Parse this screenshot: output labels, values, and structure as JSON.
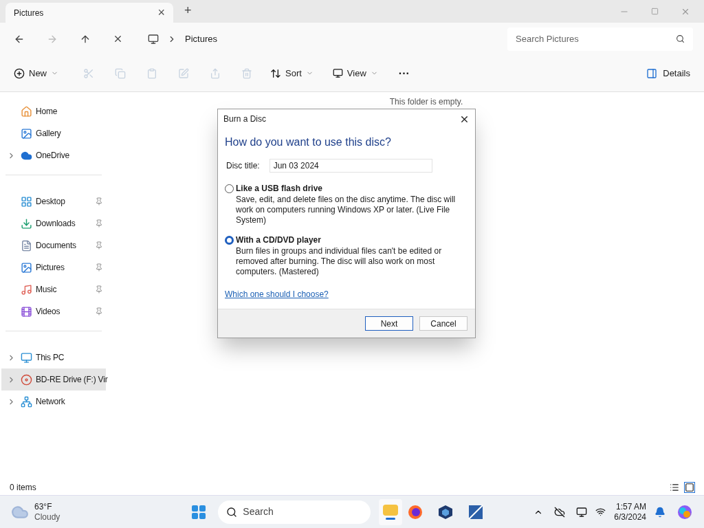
{
  "tab": {
    "title": "Pictures",
    "close": "×",
    "new": "+"
  },
  "address": {
    "breadcrumb": "Pictures",
    "search_placeholder": "Search Pictures"
  },
  "commands": {
    "new": "New",
    "sort": "Sort",
    "view": "View",
    "more": "···",
    "details": "Details"
  },
  "sidebar": {
    "groups": [
      [
        {
          "label": "Home",
          "expandable": false,
          "pinned": false,
          "selected": false
        },
        {
          "label": "Gallery",
          "expandable": false,
          "pinned": false,
          "selected": false
        },
        {
          "label": "OneDrive",
          "expandable": true,
          "pinned": false,
          "selected": false
        }
      ],
      [
        {
          "label": "Desktop",
          "expandable": false,
          "pinned": true,
          "selected": false
        },
        {
          "label": "Downloads",
          "expandable": false,
          "pinned": true,
          "selected": false
        },
        {
          "label": "Documents",
          "expandable": false,
          "pinned": true,
          "selected": false
        },
        {
          "label": "Pictures",
          "expandable": false,
          "pinned": true,
          "selected": false
        },
        {
          "label": "Music",
          "expandable": false,
          "pinned": true,
          "selected": false
        },
        {
          "label": "Videos",
          "expandable": false,
          "pinned": true,
          "selected": false
        }
      ],
      [
        {
          "label": "This PC",
          "expandable": true,
          "pinned": false,
          "selected": false
        },
        {
          "label": "BD-RE Drive (F:) Vir",
          "expandable": true,
          "pinned": false,
          "selected": true
        },
        {
          "label": "Network",
          "expandable": true,
          "pinned": false,
          "selected": false
        }
      ]
    ]
  },
  "content": {
    "empty_message": "This folder is empty."
  },
  "dialog": {
    "title": "Burn a Disc",
    "heading": "How do you want to use this disc?",
    "disc_title_label": "Disc title:",
    "disc_title_value": "Jun 03 2024",
    "options": [
      {
        "label": "Like a USB flash drive",
        "description": "Save, edit, and delete files on the disc anytime. The disc will work on computers running Windows XP or later. (Live File System)",
        "selected": false
      },
      {
        "label": "With a CD/DVD player",
        "description": "Burn files in groups and individual files can't be edited or removed after burning. The disc will also work on most computers. (Mastered)",
        "selected": true
      }
    ],
    "help_link": "Which one should I choose?",
    "buttons": [
      "Next",
      "Cancel"
    ]
  },
  "status_bar": {
    "items": "0 items"
  },
  "taskbar": {
    "temperature": "63°F",
    "condition": "Cloudy",
    "search": "Search",
    "time": "1:57 AM",
    "date": "6/3/2024"
  }
}
